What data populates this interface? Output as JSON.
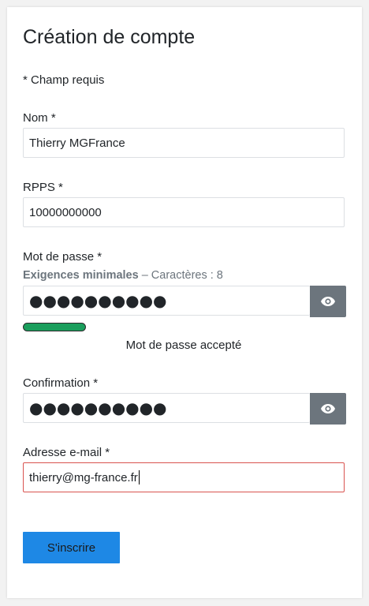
{
  "form": {
    "title": "Création de compte",
    "required_note": "* Champ requis",
    "name": {
      "label": "Nom *",
      "value": "Thierry MGFrance"
    },
    "rpps": {
      "label": "RPPS *",
      "value": "10000000000"
    },
    "password": {
      "label": "Mot de passe *",
      "requirements_strong": "Exigences minimales",
      "requirements_detail": " – Caractères : 8",
      "masked_value": "●●●●●●●●●●",
      "toggle_icon": "eye-icon",
      "strength_status": "Mot de passe accepté"
    },
    "confirmation": {
      "label": "Confirmation *",
      "masked_value": "●●●●●●●●●●",
      "toggle_icon": "eye-icon"
    },
    "email": {
      "label": "Adresse e-mail *",
      "value": "thierry@mg-france.fr"
    },
    "submit_label": "S'inscrire"
  },
  "colors": {
    "submit_bg": "#1e88e5",
    "toggle_bg": "#6c757d",
    "strength_ok": "#1a9e5c",
    "invalid_border": "#d9534f"
  }
}
